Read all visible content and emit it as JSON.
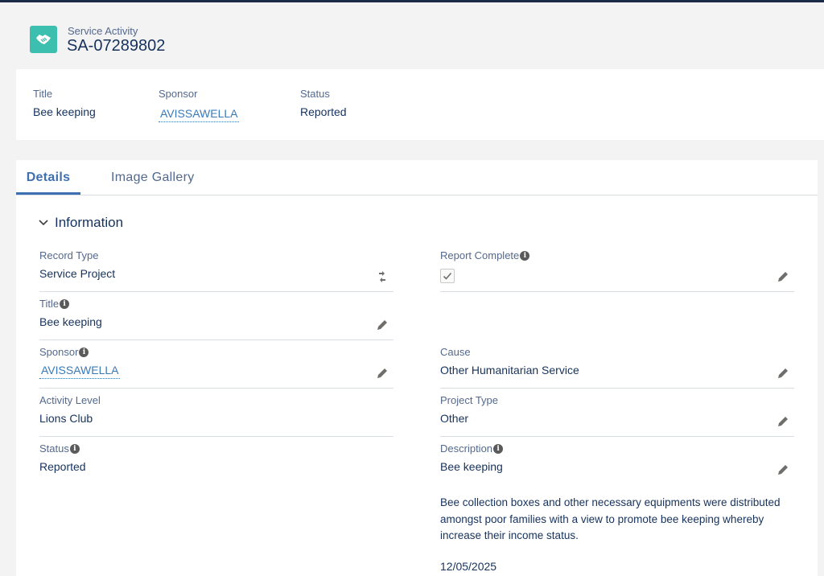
{
  "header": {
    "object_type": "Service Activity",
    "record_name": "SA-07289802",
    "icon": "handshake-icon",
    "icon_color": "#3cbfae"
  },
  "highlights": {
    "title_label": "Title",
    "title_value": "Bee keeping",
    "sponsor_label": "Sponsor",
    "sponsor_value": "AVISSAWELLA",
    "status_label": "Status",
    "status_value": "Reported"
  },
  "tabs": [
    {
      "label": "Details",
      "active": true
    },
    {
      "label": "Image Gallery",
      "active": false
    }
  ],
  "section": {
    "title": "Information",
    "expanded": true
  },
  "fields": {
    "record_type": {
      "label": "Record Type",
      "value": "Service Project"
    },
    "report_complete": {
      "label": "Report Complete",
      "checked": true
    },
    "title": {
      "label": "Title",
      "value": "Bee keeping"
    },
    "sponsor": {
      "label": "Sponsor",
      "value": "AVISSAWELLA"
    },
    "cause": {
      "label": "Cause",
      "value": "Other Humanitarian Service"
    },
    "activity_level": {
      "label": "Activity Level",
      "value": "Lions Club"
    },
    "project_type": {
      "label": "Project Type",
      "value": "Other"
    },
    "status": {
      "label": "Status",
      "value": "Reported"
    },
    "description": {
      "label": "Description",
      "value_line1": "Bee keeping",
      "value_body": "Bee collection boxes and other necessary equipments were distributed amongst poor families with a view to promote bee keeping whereby increase their income status.",
      "value_date": "12/05/2025"
    }
  },
  "colors": {
    "link": "#3a79b9",
    "active_tab": "#3e6fb0",
    "label": "#54698d",
    "value": "#16325c"
  }
}
